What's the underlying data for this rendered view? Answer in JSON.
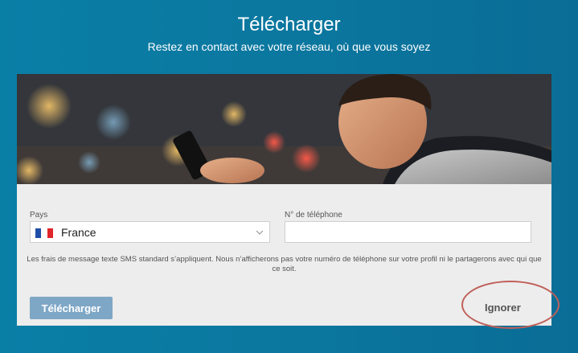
{
  "header": {
    "title": "Télécharger",
    "subtitle": "Restez en contact avec votre réseau, où que vous soyez"
  },
  "form": {
    "country_label": "Pays",
    "country_value": "France",
    "country_flag_colors": [
      "#1f4ea8",
      "#ffffff",
      "#e0262b"
    ],
    "phone_label": "N° de téléphone",
    "phone_value": "",
    "phone_placeholder": ""
  },
  "disclaimer": "Les frais de message texte SMS standard s’appliquent. Nous n’afficherons pas votre numéro de téléphone sur votre profil ni le partagerons avec qui que ce soit.",
  "actions": {
    "download_label": "Télécharger",
    "skip_label": "Ignorer"
  },
  "colors": {
    "background": "#0a7aa1",
    "primary_button": "#7ea7c6",
    "highlight_ring": "#c0605a"
  },
  "icons": {
    "select_chevron": "chevron-down-icon"
  }
}
